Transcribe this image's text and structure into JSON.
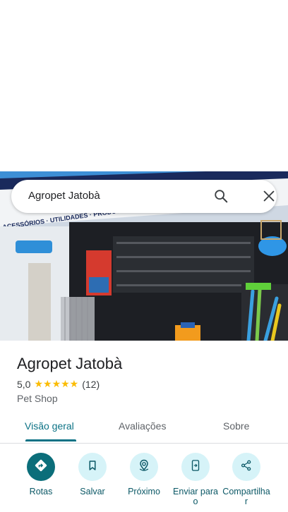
{
  "search": {
    "query": "Agropet Jatobà"
  },
  "place": {
    "name": "Agropet Jatobà",
    "rating": "5,0",
    "stars": "★★★★★",
    "reviews": "(12)",
    "category": "Pet Shop",
    "sign_text": "ACESSÓRIOS · UTILIDADES · PRODUTOS DE LIMPEZA"
  },
  "tabs": [
    {
      "label": "Visão geral"
    },
    {
      "label": "Avaliações"
    },
    {
      "label": "Sobre"
    }
  ],
  "actions": [
    {
      "label": "Rotas",
      "icon": "directions-icon"
    },
    {
      "label": "Salvar",
      "icon": "bookmark-icon"
    },
    {
      "label": "Próximo",
      "icon": "nearby-icon"
    },
    {
      "label": "Enviar para o",
      "icon": "send-to-phone-icon"
    },
    {
      "label": "Compartilhar",
      "icon": "share-icon"
    }
  ],
  "colors": {
    "accent": "#0b7285",
    "star": "#fbbc04"
  }
}
